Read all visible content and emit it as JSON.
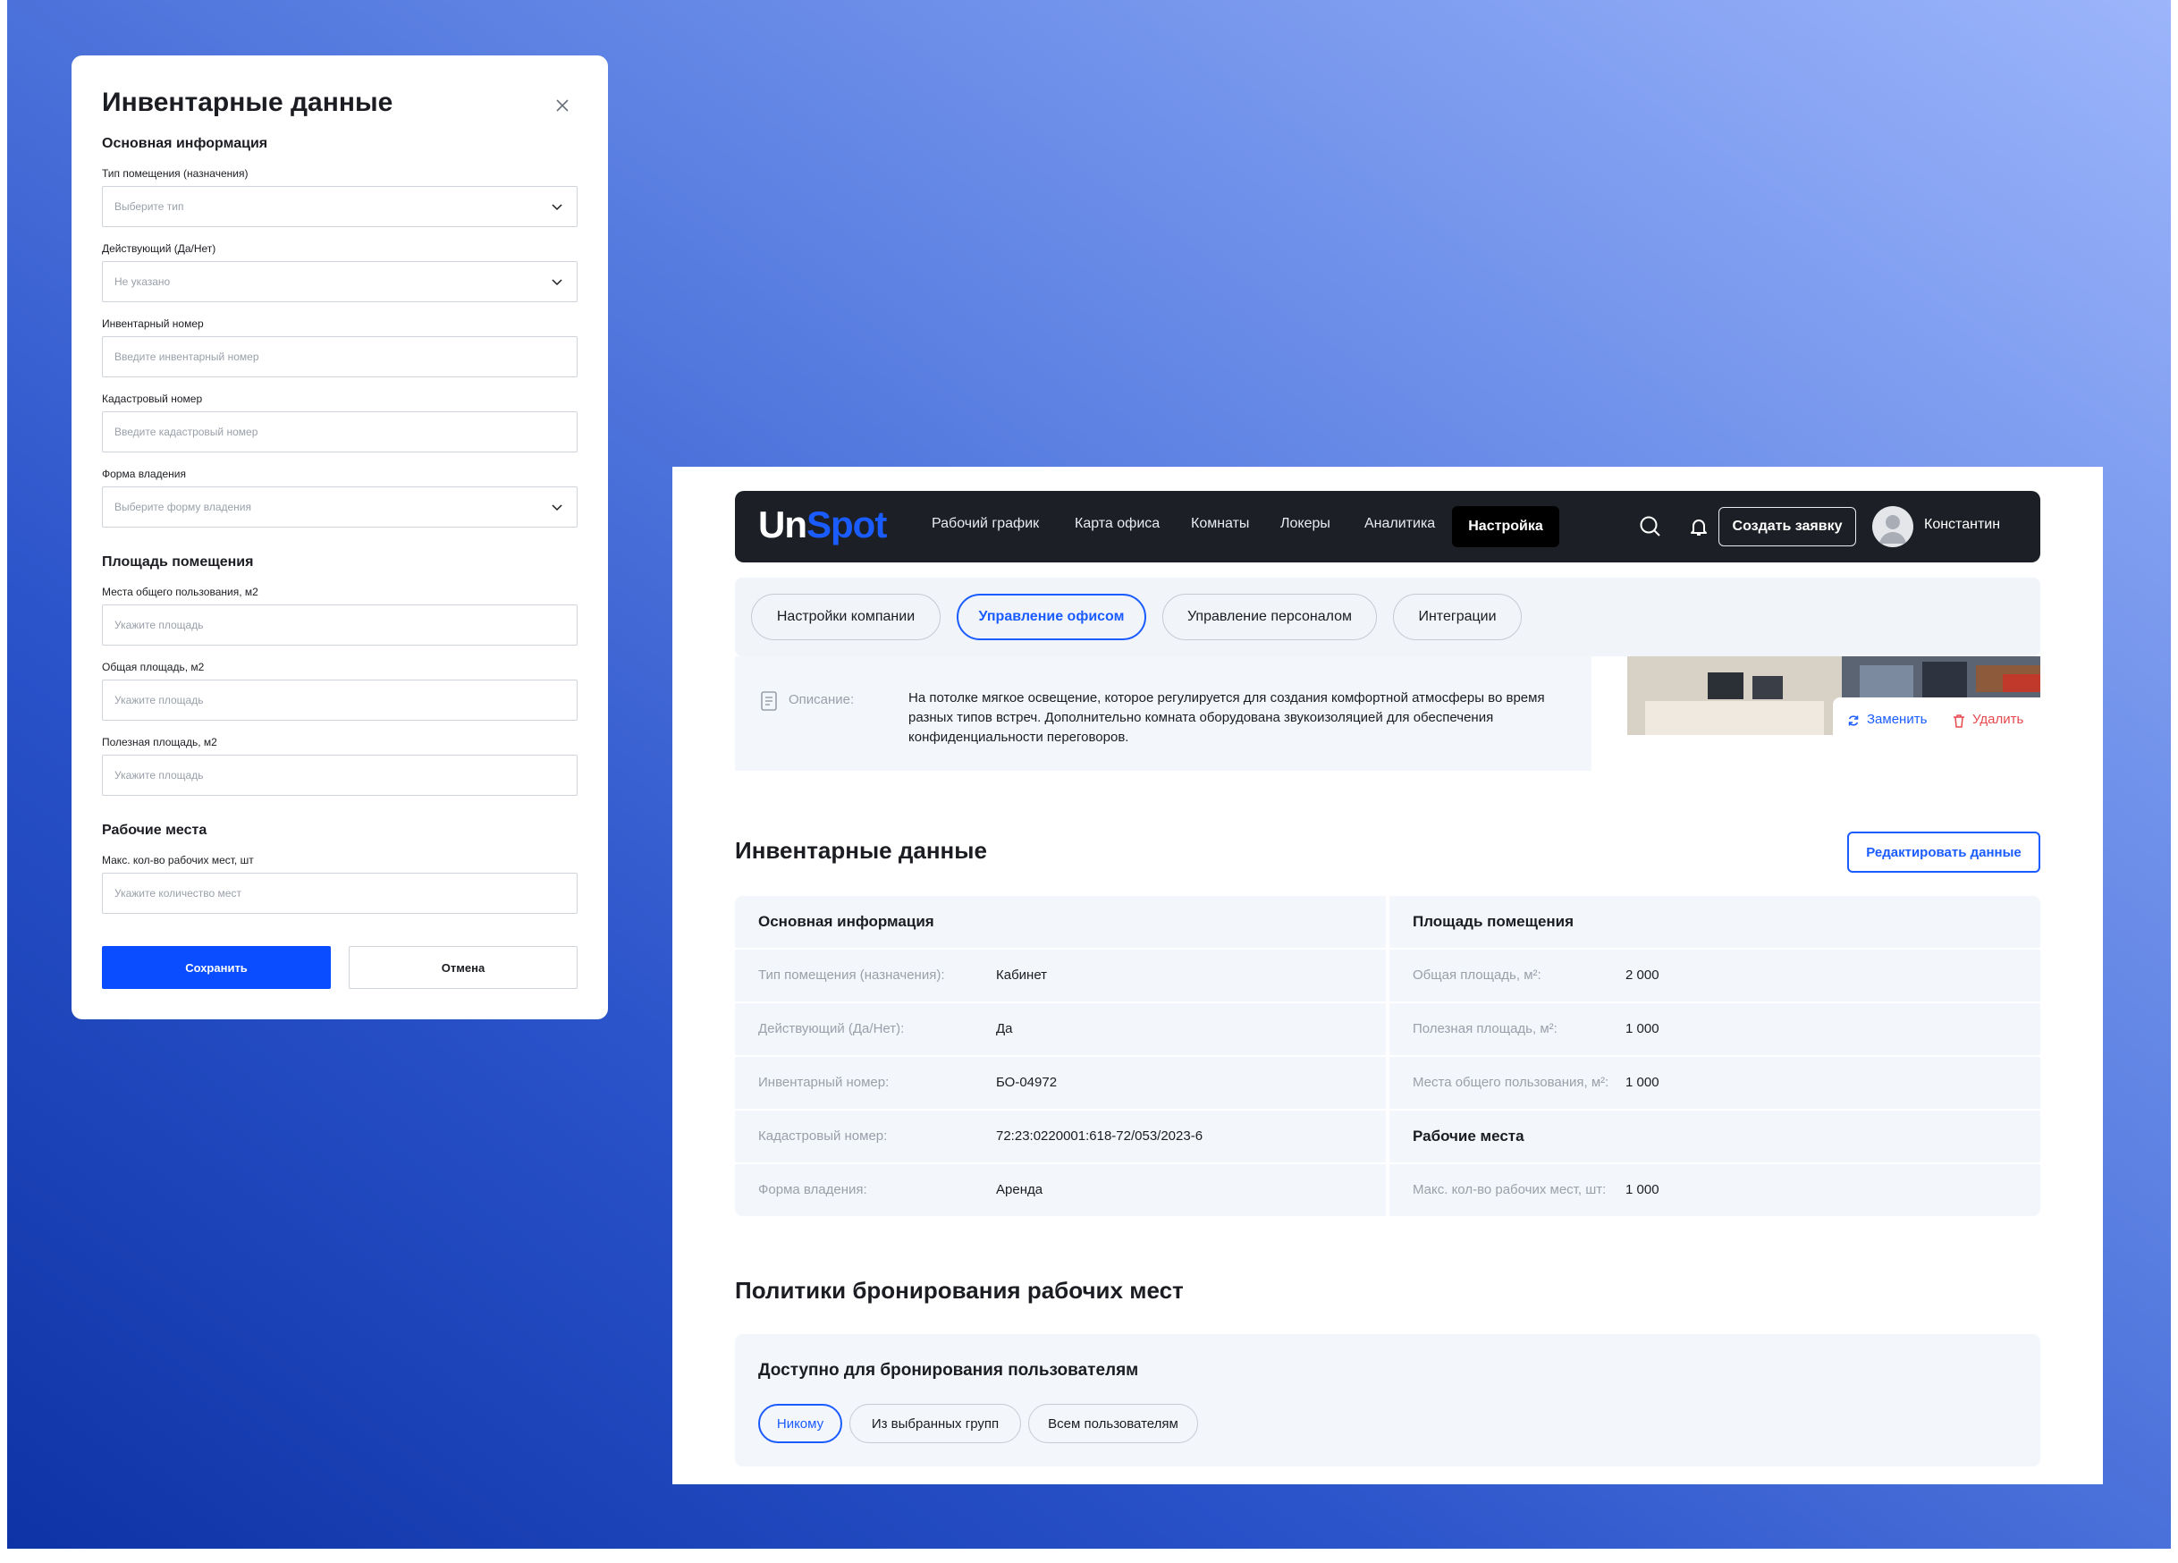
{
  "modal": {
    "title": "Инвентарные данные",
    "section_basic": "Основная информация",
    "f_type_label": "Тип помещения (назначения)",
    "f_type_placeholder": "Выберите тип",
    "f_active_label": "Действующий (Да/Нет)",
    "f_active_placeholder": "Не указано",
    "f_inv_label": "Инвентарный номер",
    "f_inv_placeholder": "Введите инвентарный номер",
    "f_cad_label": "Кадастровый номер",
    "f_cad_placeholder": "Введите кадастровый номер",
    "f_own_label": "Форма владения",
    "f_own_placeholder": "Выберите форму владения",
    "section_area": "Площадь помещения",
    "f_common_label": "Места общего пользования, м2",
    "f_common_placeholder": "Укажите площадь",
    "f_total_label": "Общая площадь, м2",
    "f_total_placeholder": "Укажите площадь",
    "f_useful_label": "Полезная площадь, м2",
    "f_useful_placeholder": "Укажите площадь",
    "section_work": "Рабочие места",
    "f_max_label": "Макс. кол-во рабочих мест, шт",
    "f_max_placeholder": "Укажите количество мест",
    "save": "Сохранить",
    "cancel": "Отмена"
  },
  "app": {
    "logo_a": "Un",
    "logo_b": "Spot",
    "nav": [
      "Рабочий график",
      "Карта офиса",
      "Комнаты",
      "Локеры",
      "Аналитика"
    ],
    "nav_active": "Настройка",
    "create_button": "Создать заявку",
    "user_name": "Константин",
    "tabs": [
      "Настройки компании",
      "Управление офисом",
      "Управление персоналом",
      "Интеграции"
    ],
    "description_key": "Описание:",
    "description_value": "На потолке мягкое освещение, которое регулируется для создания комфортной атмосферы во время разных типов встреч. Дополнительно комната оборудована звукоизоляцией для обеспечения конфиденциальности переговоров.",
    "replace": "Заменить",
    "delete": "Удалить",
    "inventory_title": "Инвентарные данные",
    "edit_button": "Редактировать данные",
    "left_header": "Основная информация",
    "right_header": "Площадь помещения",
    "left_rows": [
      {
        "k": "Тип помещения (назначения):",
        "v": "Кабинет"
      },
      {
        "k": "Действующий (Да/Нет):",
        "v": "Да"
      },
      {
        "k": "Инвентарный номер:",
        "v": "БО-04972"
      },
      {
        "k": "Кадастровый номер:",
        "v": "72:23:0220001:618-72/053/2023-6"
      },
      {
        "k": "Форма владения:",
        "v": "Аренда"
      }
    ],
    "right_rows": [
      {
        "k": "Общая площадь, м²:",
        "v": "2 000"
      },
      {
        "k": "Полезная площадь, м²:",
        "v": "1 000"
      },
      {
        "k": "Места общего пользования, м²:",
        "v": "1 000"
      }
    ],
    "work_header": "Рабочие места",
    "work_row": {
      "k": "Макс. кол-во рабочих мест, шт:",
      "v": "1 000"
    },
    "policy_title": "Политики бронирования рабочих мест",
    "policy_sub": "Доступно для бронирования пользователям",
    "policy_chips": [
      "Никому",
      "Из выбранных групп",
      "Всем пользователям"
    ]
  },
  "colors": {
    "accent": "#1a5cff",
    "nav_bg": "#1c1f26",
    "save_bg": "#0a4cff"
  }
}
